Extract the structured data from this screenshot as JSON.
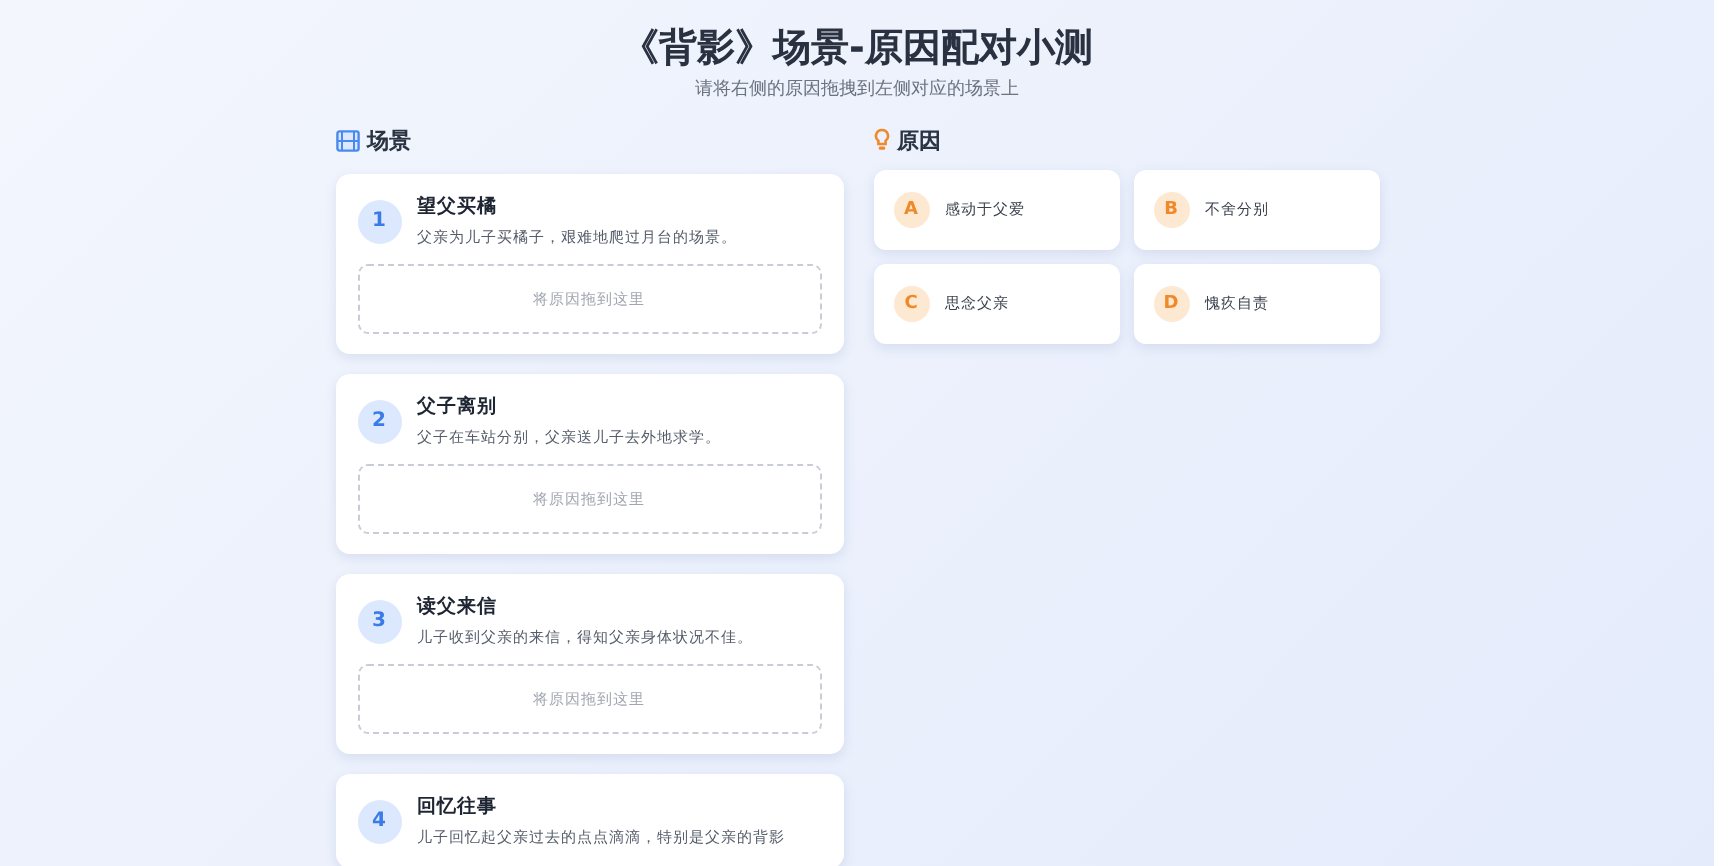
{
  "header": {
    "title": "《背影》场景-原因配对小测",
    "subtitle": "请将右侧的原因拖拽到左侧对应的场景上"
  },
  "scenes": {
    "heading": "场景",
    "items": [
      {
        "number": "1",
        "title": "望父买橘",
        "description": "父亲为儿子买橘子，艰难地爬过月台的场景。",
        "drop_placeholder": "将原因拖到这里"
      },
      {
        "number": "2",
        "title": "父子离别",
        "description": "父子在车站分别，父亲送儿子去外地求学。",
        "drop_placeholder": "将原因拖到这里"
      },
      {
        "number": "3",
        "title": "读父来信",
        "description": "儿子收到父亲的来信，得知父亲身体状况不佳。",
        "drop_placeholder": "将原因拖到这里"
      },
      {
        "number": "4",
        "title": "回忆往事",
        "description": "儿子回忆起父亲过去的点点滴滴，特别是父亲的背影"
      }
    ]
  },
  "reasons": {
    "heading": "原因",
    "items": [
      {
        "letter": "A",
        "text": "感动于父爱"
      },
      {
        "letter": "B",
        "text": "不舍分别"
      },
      {
        "letter": "C",
        "text": "思念父亲"
      },
      {
        "letter": "D",
        "text": "愧疚自责"
      }
    ]
  }
}
